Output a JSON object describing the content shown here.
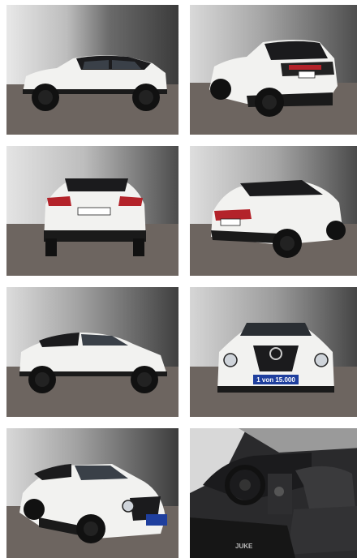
{
  "gallery": {
    "photos": [
      {
        "view": "side-left"
      },
      {
        "view": "rear-three-quarter-left"
      },
      {
        "view": "rear"
      },
      {
        "view": "rear-three-quarter-right"
      },
      {
        "view": "side-left-alt"
      },
      {
        "view": "front"
      },
      {
        "view": "front-three-quarter"
      },
      {
        "view": "interior"
      }
    ],
    "front_plate_text": "1 von 15.000",
    "interior_badge_text": "JUKE"
  },
  "colors": {
    "body": "#f2f2f0",
    "roof": "#1c1c1e",
    "floor": "#6a625b",
    "backdrop": "#3a3a3a",
    "plate_blue": "#1f3f9e"
  }
}
